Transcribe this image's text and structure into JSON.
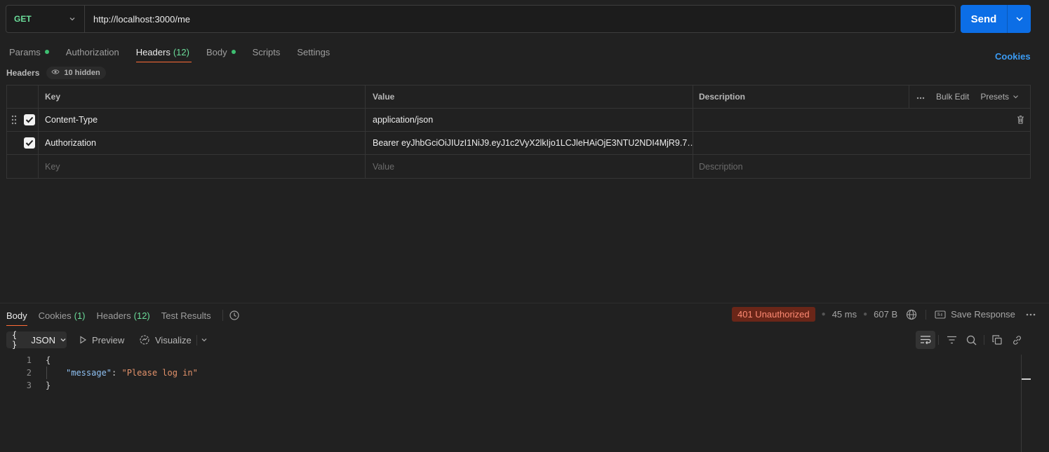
{
  "request": {
    "method": "GET",
    "url": "http://localhost:3000/me",
    "send_label": "Send"
  },
  "request_tabs": [
    {
      "label": "Params",
      "dot": true
    },
    {
      "label": "Authorization"
    },
    {
      "label": "Headers",
      "count": "(12)",
      "active": true
    },
    {
      "label": "Body",
      "dot": true
    },
    {
      "label": "Scripts"
    },
    {
      "label": "Settings"
    }
  ],
  "cookies_label": "Cookies",
  "headers_section": {
    "title": "Headers",
    "hidden_label": "10 hidden"
  },
  "table": {
    "columns": {
      "key": "Key",
      "value": "Value",
      "description": "Description"
    },
    "bulk_edit": "Bulk Edit",
    "presets": "Presets",
    "rows": [
      {
        "key": "Content-Type",
        "value": "application/json",
        "checked": true
      },
      {
        "key": "Authorization",
        "value": "Bearer eyJhbGciOiJIUzI1NiJ9.eyJ1c2VyX2lkIjo1LCJleHAiOjE3NTU2NDI4MjR9.7…",
        "checked": true
      }
    ],
    "placeholders": {
      "key": "Key",
      "value": "Value",
      "description": "Description"
    }
  },
  "response_tabs": [
    {
      "label": "Body",
      "active": true
    },
    {
      "label": "Cookies",
      "count": "(1)"
    },
    {
      "label": "Headers",
      "count": "(12)"
    },
    {
      "label": "Test Results"
    }
  ],
  "response_status": {
    "status": "401 Unauthorized",
    "time": "45 ms",
    "size": "607 B",
    "save_label": "Save Response"
  },
  "body_format": {
    "format": "JSON",
    "format_glyph": "{ }",
    "preview": "Preview",
    "visualize": "Visualize"
  },
  "code_lines": [
    {
      "n": "1",
      "text": "{"
    },
    {
      "n": "2",
      "key": "\"message\"",
      "colon": ": ",
      "str": "\"Please log in\""
    },
    {
      "n": "3",
      "text": "}"
    }
  ],
  "colors": {
    "accent_tab": "#ff6c37",
    "send": "#0c6ee6",
    "method_get": "#6bdd9a",
    "status_error_bg": "#6a2618",
    "status_error_fg": "#ff8a73"
  }
}
